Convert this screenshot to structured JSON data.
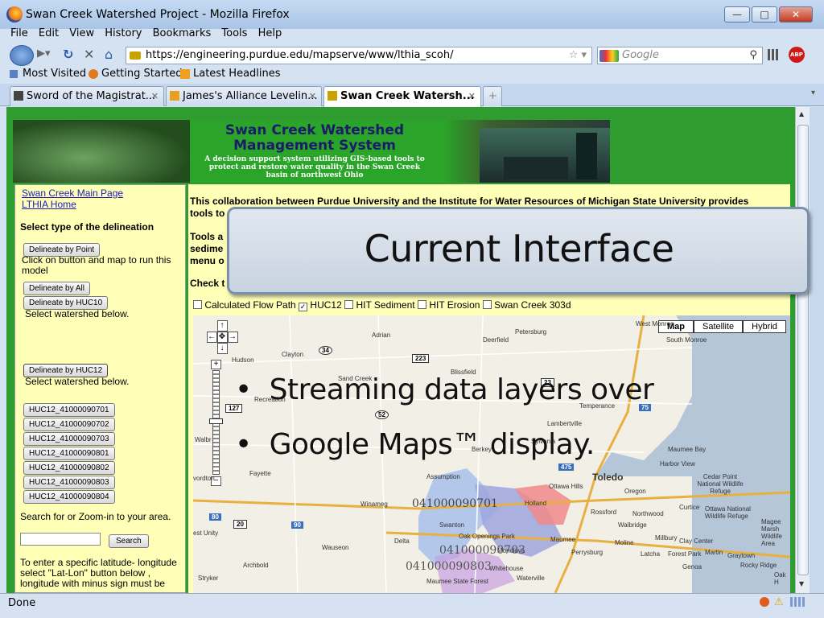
{
  "window": {
    "title": "Swan Creek Watershed Project - Mozilla Firefox"
  },
  "menu": [
    "File",
    "Edit",
    "View",
    "History",
    "Bookmarks",
    "Tools",
    "Help"
  ],
  "nav": {
    "url": "https://engineering.purdue.edu/mapserve/www/lthia_scoh/",
    "search_placeholder": "Google"
  },
  "bookmarks": [
    "Most Visited",
    "Getting Started",
    "Latest Headlines"
  ],
  "tabs": [
    "Sword of the Magistrat...",
    "James's Alliance Levelin...",
    "Swan Creek Watersh..."
  ],
  "banner": {
    "title": "Swan Creek Watershed Management System",
    "subtitle": "A decision support system utilizing GIS-based tools to protect and restore water quality in the Swan Creek basin of northwest Ohio"
  },
  "sidebar": {
    "link1": "Swan Creek Main Page",
    "link2": "LTHIA Home",
    "heading": "Select type of the delineation",
    "btn_point": "Delineate by Point",
    "point_hint": "Click on button and map to run this model",
    "btn_all": "Delineate by All",
    "btn_huc10": "Delineate by HUC10",
    "select_hint1": "Select watershed below.",
    "btn_huc12": "Delineate by HUC12",
    "select_hint2": "Select watershed below.",
    "hucs": [
      "HUC12_41000090701",
      "HUC12_41000090702",
      "HUC12_41000090703",
      "HUC12_41000090801",
      "HUC12_41000090802",
      "HUC12_41000090803",
      "HUC12_41000090804"
    ],
    "search_label": "Search for or Zoom-in to your area.",
    "search_btn": "Search",
    "latlon_text": "To enter a specific latitude- longitude select \"Lat-Lon\" button below , longitude with minus sign must be"
  },
  "main": {
    "intro1": "This collaboration between Purdue University and the Institute for Water Resources of Michigan State University provides",
    "intro2": "tools to",
    "tools_a": "Tools a",
    "sedime": "sedime",
    "menu_o": "menu o",
    "check": "Check t",
    "layers": [
      "Calculated Flow Path",
      "HUC12",
      "HIT Sediment",
      "HIT Erosion",
      "Swan Creek 303d"
    ],
    "map_types": [
      "Map",
      "Satellite",
      "Hybrid"
    ]
  },
  "map_labels": [
    "Adrian",
    "Deerfield",
    "Petersburg",
    "West Monroe",
    "South Monroe",
    "Clayton",
    "Hudson",
    "Blissfield",
    "Sand Creek",
    "Temperance",
    "Lambertville",
    "Berkey",
    "Sylvania",
    "Maumee Bay",
    "Harbor View",
    "Fayette",
    "Assumption",
    "Ottawa Hills",
    "Toledo",
    "Oregon",
    "Cedar Point National Wildlife Refuge",
    "Holland",
    "Rossford",
    "Northwood",
    "Curtice",
    "Ottawa National Wildlife Refuge",
    "Winameg",
    "Swanton",
    "Delta",
    "Oak Openings Park",
    "Monclova",
    "Maumee",
    "Perrysburg",
    "Walbridge",
    "Millbury",
    "Clay Center",
    "Forest Park",
    "Martin",
    "Graytown",
    "Wauseon",
    "Archbold",
    "Whitehouse",
    "Waterville",
    "Maumee State Forest",
    "Latcha",
    "Genoa",
    "Rocky Ridge",
    "Stryker",
    "Moline",
    "Magee Marsh Wildlife Area",
    "Oak H",
    "Recreation",
    "Walbr",
    "vordton",
    "est Unity"
  ],
  "map_roads": [
    "34",
    "223",
    "23",
    "52",
    "127",
    "475",
    "80",
    "20",
    "90",
    "75"
  ],
  "map_polygons": [
    "041000090701",
    "041000090703",
    "041000090803"
  ],
  "slide": {
    "callout": "Current Interface",
    "bullets": [
      "Streaming data layers over",
      "Google Maps™ display."
    ]
  },
  "status": "Done"
}
